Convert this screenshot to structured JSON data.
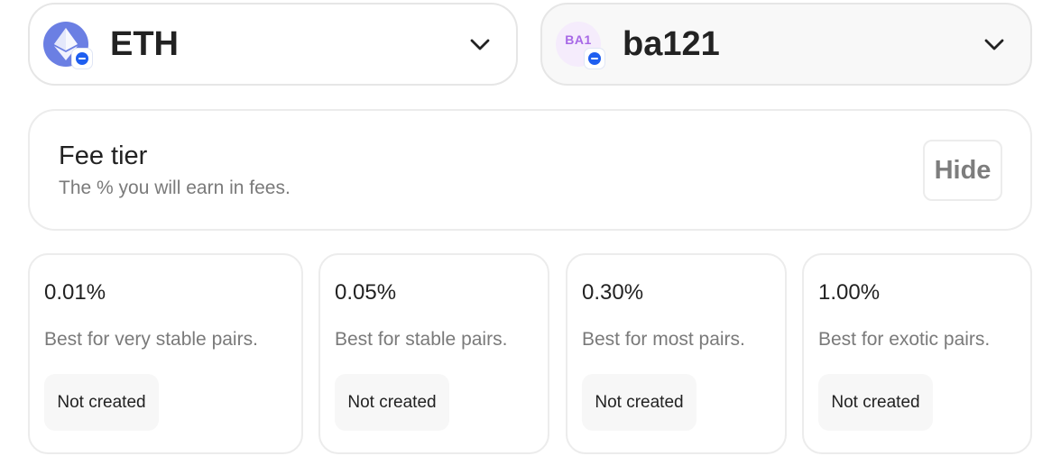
{
  "token_a": {
    "symbol": "ETH",
    "logo": "eth-icon",
    "chain_badge": "chain-badge-icon"
  },
  "token_b": {
    "symbol": "ba121",
    "logo_text": "BA1",
    "chain_badge": "chain-badge-icon"
  },
  "fee_tier": {
    "title": "Fee tier",
    "subtitle": "The % you will earn in fees.",
    "hide_label": "Hide"
  },
  "tiers": [
    {
      "percent": "0.01%",
      "description": "Best for very stable pairs.",
      "status": "Not created"
    },
    {
      "percent": "0.05%",
      "description": "Best for stable pairs.",
      "status": "Not created"
    },
    {
      "percent": "0.30%",
      "description": "Best for most pairs.",
      "status": "Not created"
    },
    {
      "percent": "1.00%",
      "description": "Best for exotic pairs.",
      "status": "Not created"
    }
  ],
  "colors": {
    "eth_logo": "#6b7fe3",
    "chain_badge": "#1e5ef0",
    "ba_logo_text": "#a768e6",
    "muted_text": "#7a7a7a",
    "border": "#ececec"
  }
}
